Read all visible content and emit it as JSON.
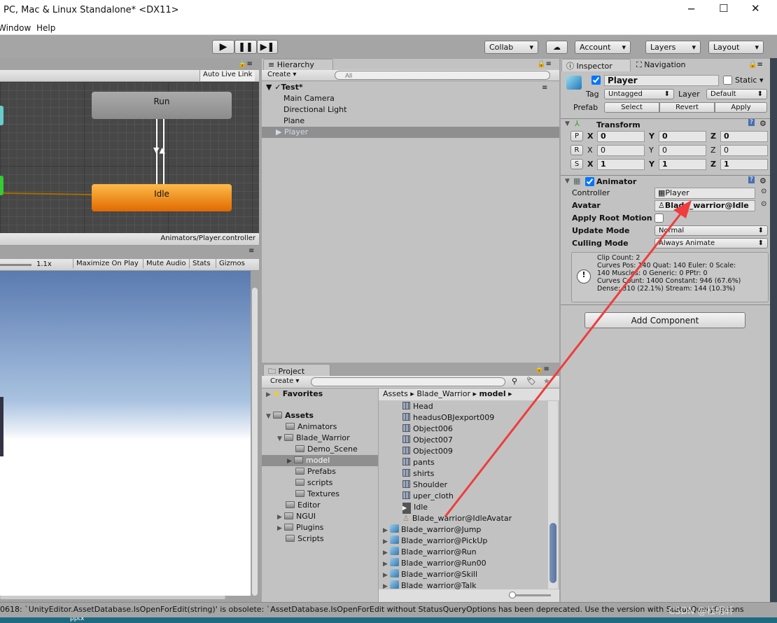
{
  "window": {
    "title": "PC, Mac & Linux Standalone* <DX11>",
    "controls": [
      "minimize",
      "maximize",
      "close"
    ]
  },
  "menu": [
    "Window",
    "Help"
  ],
  "toolbar": {
    "play": "play-icon",
    "pause": "pause-icon",
    "step": "step-icon",
    "collab": "Collab",
    "cloud": "cloud-icon",
    "account": "Account",
    "layers": "Layers",
    "layout": "Layout"
  },
  "animator": {
    "auto_live_link": "Auto Live Link",
    "states": [
      {
        "name": "Run",
        "color": "#9a9a9a"
      },
      {
        "name": "Idle",
        "color": "#f08c10"
      }
    ],
    "path": "Animators/Player.controller"
  },
  "game": {
    "scale": "1.1x",
    "buttons": [
      "Maximize On Play",
      "Mute Audio",
      "Stats",
      "Gizmos"
    ]
  },
  "hierarchy": {
    "tab": "Hierarchy",
    "create": "Create",
    "search_placeholder": "All",
    "scene": "Test*",
    "items": [
      "Main Camera",
      "Directional Light",
      "Plane",
      "Player"
    ],
    "selected": "Player"
  },
  "project": {
    "tab": "Project",
    "create": "Create",
    "tree": {
      "favorites": "Favorites",
      "assets": "Assets",
      "folders": [
        "Animators",
        "Blade_Warrior",
        "Demo_Scene",
        "model",
        "Prefabs",
        "scripts",
        "Textures",
        "Editor",
        "NGUI",
        "Plugins",
        "Scripts"
      ]
    },
    "breadcrumb": [
      "Assets",
      "Blade_Warrior",
      "model"
    ],
    "files": [
      {
        "name": "Head",
        "type": "mesh"
      },
      {
        "name": "headusOBJexport009",
        "type": "mesh"
      },
      {
        "name": "Object006",
        "type": "mesh"
      },
      {
        "name": "Object007",
        "type": "mesh"
      },
      {
        "name": "Object009",
        "type": "mesh"
      },
      {
        "name": "pants",
        "type": "mesh"
      },
      {
        "name": "shirts",
        "type": "mesh"
      },
      {
        "name": "Shoulder",
        "type": "mesh"
      },
      {
        "name": "uper_cloth",
        "type": "mesh"
      },
      {
        "name": "Idle",
        "type": "clip"
      },
      {
        "name": "Blade_warrior@IdleAvatar",
        "type": "avatar"
      },
      {
        "name": "Blade_warrior@Jump",
        "type": "model"
      },
      {
        "name": "Blade_warrior@PickUp",
        "type": "model"
      },
      {
        "name": "Blade_warrior@Run",
        "type": "model"
      },
      {
        "name": "Blade_warrior@Run00",
        "type": "model"
      },
      {
        "name": "Blade_warrior@Skill",
        "type": "model"
      },
      {
        "name": "Blade_warrior@Talk",
        "type": "model"
      }
    ]
  },
  "inspector": {
    "tab": "Inspector",
    "nav_tab": "Navigation",
    "name": "Player",
    "static": "Static",
    "tag_label": "Tag",
    "tag": "Untagged",
    "layer_label": "Layer",
    "layer": "Default",
    "prefab_label": "Prefab",
    "prefab_buttons": [
      "Select",
      "Revert",
      "Apply"
    ],
    "transform": {
      "title": "Transform",
      "rows": [
        {
          "btn": "P",
          "x": "0",
          "y": "0",
          "z": "0"
        },
        {
          "btn": "R",
          "x": "0",
          "y": "0",
          "z": "0"
        },
        {
          "btn": "S",
          "x": "1",
          "y": "1",
          "z": "1"
        }
      ]
    },
    "animator": {
      "title": "Animator",
      "controller_label": "Controller",
      "controller": "Player",
      "avatar_label": "Avatar",
      "avatar": "Blade_warrior@Idle",
      "root_motion_label": "Apply Root Motion",
      "update_label": "Update Mode",
      "update": "Normal",
      "culling_label": "Culling Mode",
      "culling": "Always Animate",
      "info": [
        "Clip Count: 2",
        "Curves Pos: 140 Quat: 140 Euler: 0 Scale:",
        "140 Muscles: 0 Generic: 0 PPtr: 0",
        "Curves Count: 1400 Constant: 946 (67.6%)",
        "Dense: 310 (22.1%) Stream: 144 (10.3%)"
      ]
    },
    "add_component": "Add Component"
  },
  "status": "0618: `UnityEditor.AssetDatabase.IsOpenForEdit(string)' is obsolete: `AssetDatabase.IsOpenForEdit without StatusQueryOptions has been deprecated. Use the version with StatusQueryOptions",
  "watermark": "CSDN @杜明轩",
  "taskbar_text": "pptx",
  "annotation_color": "#f03c3c"
}
